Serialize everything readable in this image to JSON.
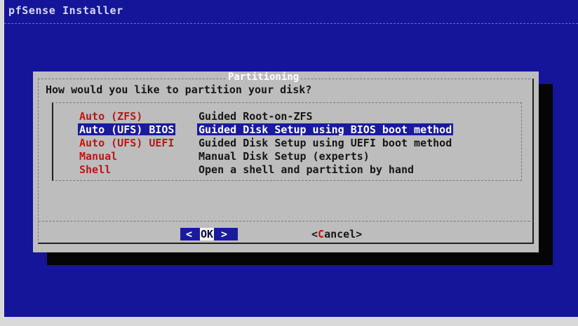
{
  "app": {
    "backtitle": "pfSense Installer"
  },
  "dialog": {
    "title": "Partitioning",
    "prompt": "How would you like to partition your disk?",
    "selected_index": 1,
    "menu": [
      {
        "hotkey": "A",
        "tag_rest": "uto (ZFS)",
        "description": "Guided Root-on-ZFS"
      },
      {
        "hotkey": "A",
        "tag_rest": "uto (UFS) BIOS",
        "description": "Guided Disk Setup using BIOS boot method"
      },
      {
        "hotkey": "A",
        "tag_rest": "uto (UFS) UEFI",
        "description": "Guided Disk Setup using UEFI boot method"
      },
      {
        "hotkey": "M",
        "tag_rest": "anual",
        "description": "Manual Disk Setup (experts)"
      },
      {
        "hotkey": "S",
        "tag_rest": "hell",
        "description": "Open a shell and partition by hand"
      }
    ],
    "buttons": {
      "ok": {
        "left_bracket": "<",
        "hotkey": "O",
        "rest": "K",
        "right_bracket": ">"
      },
      "cancel": {
        "left_bracket": "<",
        "hotkey": "C",
        "rest": "ancel",
        "right_bracket": ">"
      }
    }
  },
  "colors": {
    "screen_bg": "#15159a",
    "dialog_bg": "#bdbdbd",
    "highlight_bg": "#1a1a9e",
    "hotkey": "#c41010"
  }
}
